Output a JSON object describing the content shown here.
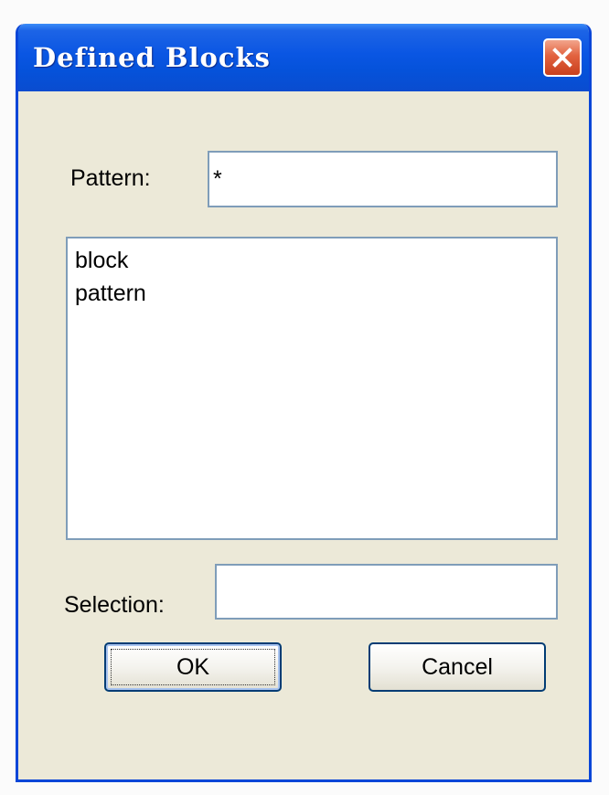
{
  "window": {
    "title": "Defined Blocks"
  },
  "form": {
    "pattern_label": "Pattern:",
    "pattern_value": "*",
    "list_items": [
      "block",
      "pattern"
    ],
    "selection_label": "Selection:",
    "selection_value": ""
  },
  "buttons": {
    "ok_label": "OK",
    "cancel_label": "Cancel"
  },
  "icons": {
    "close": "close-icon"
  },
  "colors": {
    "titlebar": "#0a56e3",
    "window_bg": "#ece9d8",
    "close_button": "#e2623f",
    "field_border": "#7f9db9"
  }
}
